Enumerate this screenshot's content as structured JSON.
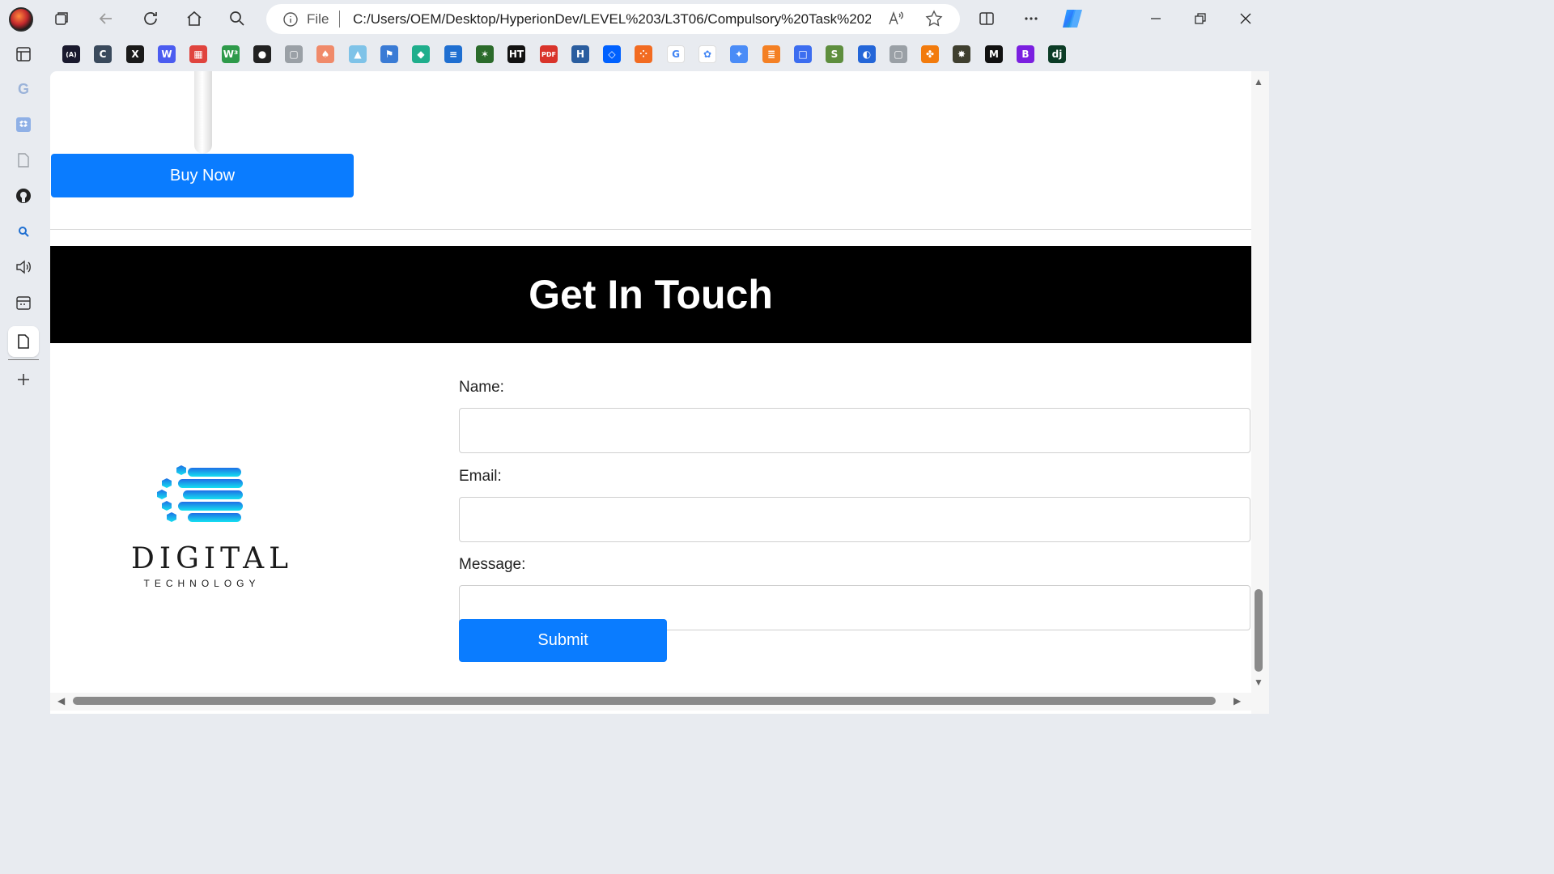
{
  "browser": {
    "address": {
      "scheme_label": "File",
      "url": "C:/Users/OEM/Desktop/HyperionDev/LEVEL%203/L3T06/Compulsory%20Task%202..."
    },
    "bookmarks": [
      {
        "icon": "dev-icon",
        "glyph": "(A)",
        "color": "#1a1a2e"
      },
      {
        "icon": "c-doc-icon",
        "glyph": "C",
        "color": "#3a4a5c"
      },
      {
        "icon": "x-icon",
        "glyph": "X",
        "color": "#1a1a1a"
      },
      {
        "icon": "w-icon",
        "glyph": "W",
        "color": "#4b5cf0"
      },
      {
        "icon": "grid-color-icon",
        "glyph": "▦",
        "color": "#e0443e"
      },
      {
        "icon": "w3-icon",
        "glyph": "W³",
        "color": "#2e9a4a"
      },
      {
        "icon": "github-icon",
        "glyph": "●",
        "color": "#222222"
      },
      {
        "icon": "page-icon",
        "glyph": "▢",
        "color": "#9aa0a6"
      },
      {
        "icon": "mushroom-icon",
        "glyph": "♠",
        "color": "#f08a6a"
      },
      {
        "icon": "people-icon",
        "glyph": "▲",
        "color": "#7fc3e8"
      },
      {
        "icon": "flag-icon",
        "glyph": "⚑",
        "color": "#3a7bd5"
      },
      {
        "icon": "cube-icon",
        "glyph": "◆",
        "color": "#1fae8c"
      },
      {
        "icon": "layers-icon",
        "glyph": "≡",
        "color": "#1f6fd1"
      },
      {
        "icon": "leaf-icon",
        "glyph": "✶",
        "color": "#2b6b2b"
      },
      {
        "icon": "ht-icon",
        "glyph": "HT",
        "color": "#121212"
      },
      {
        "icon": "pdf-icon",
        "glyph": "PDF",
        "color": "#d9342b"
      },
      {
        "icon": "h-icon",
        "glyph": "H",
        "color": "#2a5d9f"
      },
      {
        "icon": "dropbox-icon",
        "glyph": "◇",
        "color": "#0061ff"
      },
      {
        "icon": "dots-icon",
        "glyph": "⁘",
        "color": "#f26b21"
      },
      {
        "icon": "google-icon",
        "glyph": "G",
        "color": "#ffffff"
      },
      {
        "icon": "openai-icon",
        "glyph": "✿",
        "color": "#ffffff"
      },
      {
        "icon": "sparkle-icon",
        "glyph": "✦",
        "color": "#4a8cf7"
      },
      {
        "icon": "stackoverflow-icon",
        "glyph": "≣",
        "color": "#f48024"
      },
      {
        "icon": "square-icon",
        "glyph": "□",
        "color": "#3c6df0"
      },
      {
        "icon": "shopify-icon",
        "glyph": "S",
        "color": "#5e8e3e"
      },
      {
        "icon": "circle-half-icon",
        "glyph": "◐",
        "color": "#2466d8"
      },
      {
        "icon": "doc-icon",
        "glyph": "▢",
        "color": "#9aa0a6"
      },
      {
        "icon": "figma-icon",
        "glyph": "✤",
        "color": "#f27b0d"
      },
      {
        "icon": "cat-icon",
        "glyph": "✸",
        "color": "#3f3f2f"
      },
      {
        "icon": "m-icon",
        "glyph": "M",
        "color": "#111111"
      },
      {
        "icon": "bootstrap-icon",
        "glyph": "B",
        "color": "#7b1fe0"
      },
      {
        "icon": "django-icon",
        "glyph": "dj",
        "color": "#0c3c26"
      }
    ],
    "sidebar": [
      {
        "icon": "google-icon"
      },
      {
        "icon": "dropbox-icon"
      },
      {
        "icon": "page-icon"
      },
      {
        "icon": "github-icon"
      },
      {
        "icon": "search-icon"
      },
      {
        "icon": "speaker-icon"
      },
      {
        "icon": "calendar-icon"
      },
      {
        "icon": "document-icon"
      },
      {
        "icon": "add-icon"
      }
    ]
  },
  "page": {
    "buy_button": "Buy Now",
    "contact_title": "Get In Touch",
    "logo": {
      "word": "DIGITAL",
      "sub": "TECHNOLOGY"
    },
    "form": {
      "name_label": "Name:",
      "email_label": "Email:",
      "message_label": "Message:",
      "name_value": "",
      "email_value": "",
      "message_value": "",
      "submit_label": "Submit"
    }
  },
  "colors": {
    "primary": "#0a7cff",
    "banner_bg": "#000000",
    "chrome_bg": "#e8ebf0"
  }
}
